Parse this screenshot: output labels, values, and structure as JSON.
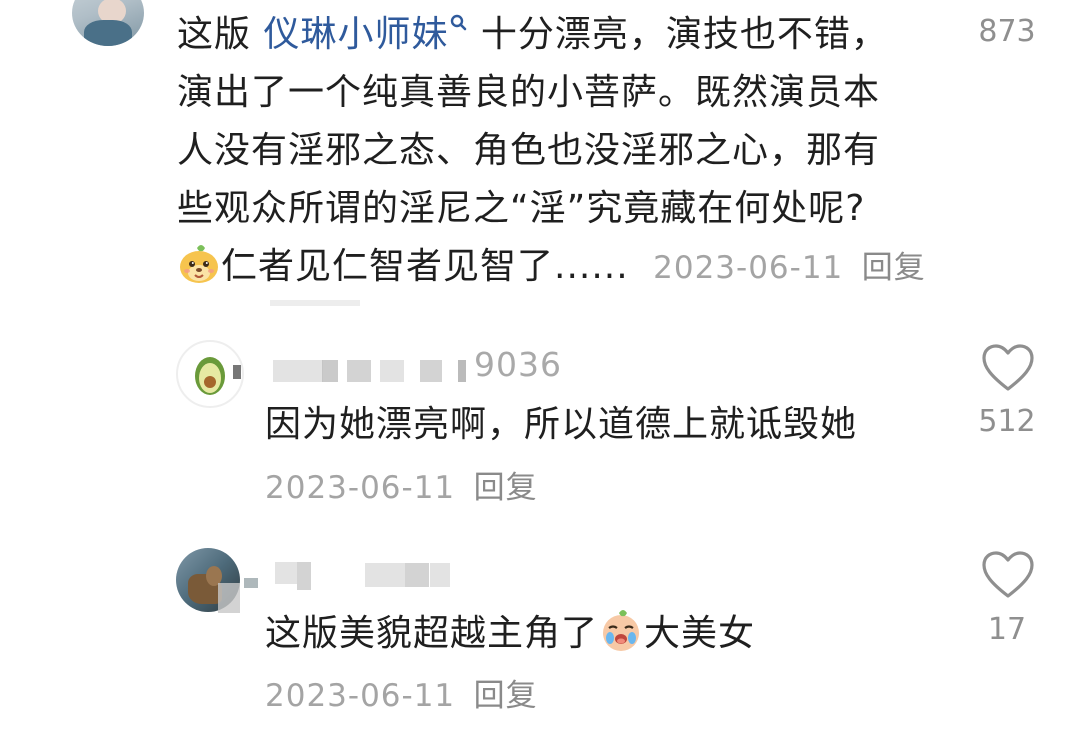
{
  "comment1": {
    "prefix": "这版 ",
    "mention": "仪琳小师妹",
    "lines": [
      " 十分漂亮，演技也不错，",
      "演出了一个纯真善良的小菩萨。既然演员本",
      "人没有淫邪之态、角色也没淫邪之心，那有",
      "些观众所谓的淫尼之“淫”究竟藏在何处呢?",
      "仁者见仁智者见智了......"
    ],
    "date": "2023-06-11",
    "reply": "回复",
    "likes": "873"
  },
  "reply1": {
    "username_tail": "9036",
    "text": "因为她漂亮啊，所以道德上就诋毁她",
    "date": "2023-06-11",
    "reply": "回复",
    "likes": "512"
  },
  "reply2": {
    "text_before": "这版美貌超越主角了",
    "text_after": "大美女",
    "date": "2023-06-11",
    "reply": "回复",
    "likes": "17"
  },
  "icons": {
    "heart": "heart-outline-icon",
    "search": "search-icon",
    "emoji1": "dog-face-emoji-icon",
    "emoji2": "crying-face-emoji-icon"
  },
  "colors": {
    "text": "#1f1f1f",
    "meta": "#a4a4a4",
    "mention": "#2f5a9c"
  }
}
